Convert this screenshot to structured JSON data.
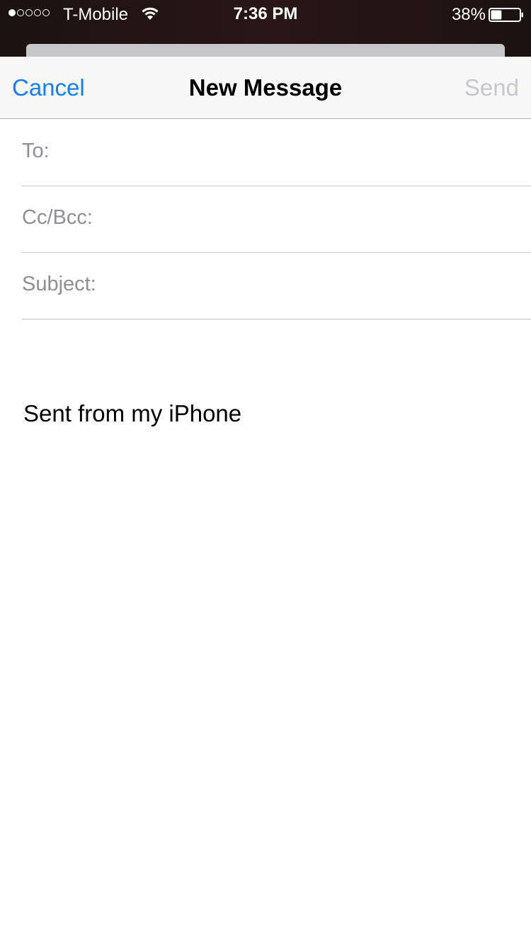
{
  "status_bar": {
    "signal_dots_filled": 1,
    "signal_dots_total": 5,
    "carrier": "T-Mobile",
    "wifi_icon": "wifi-icon",
    "time": "7:36 PM",
    "battery_percent_text": "38%",
    "battery_level": 0.38
  },
  "nav": {
    "cancel_label": "Cancel",
    "title": "New Message",
    "send_label": "Send",
    "accent_color": "#147efb",
    "disabled_color": "#c7c7cc"
  },
  "fields": {
    "to_label": "To:",
    "to_value": "",
    "cc_label": "Cc/Bcc:",
    "cc_value": "",
    "subject_label": "Subject:",
    "subject_value": ""
  },
  "body": {
    "signature": "Sent from my iPhone"
  }
}
